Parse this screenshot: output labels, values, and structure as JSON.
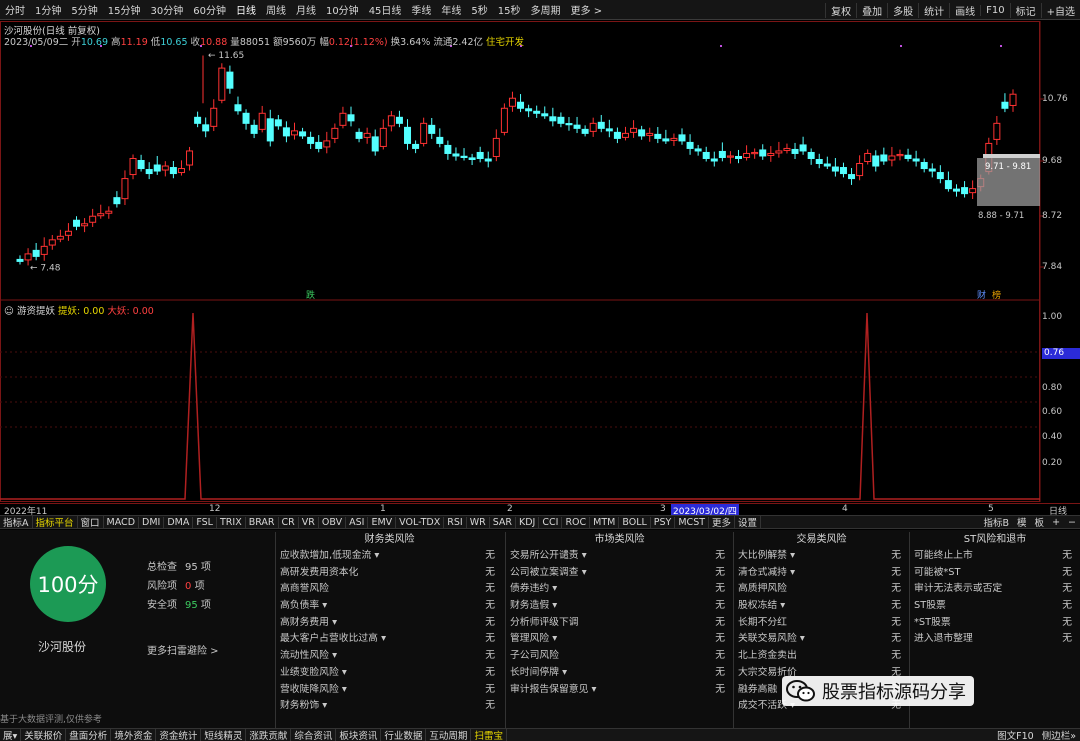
{
  "toolbar": {
    "timeframes": [
      "分时",
      "1分钟",
      "5分钟",
      "15分钟",
      "30分钟",
      "60分钟",
      "日线",
      "周线",
      "月线",
      "10分钟",
      "45日线",
      "季线",
      "年线",
      "5秒",
      "15秒",
      "多周期",
      "更多 >"
    ],
    "selected": "日线",
    "right": [
      "复权",
      "叠加",
      "多股",
      "统计",
      "画线",
      "F10",
      "标记",
      "+自选"
    ]
  },
  "stock": {
    "title": "沙河股份(日线 前复权)",
    "date": "2023/05/09二",
    "open_label": "开",
    "open": "10.69",
    "high_label": "高",
    "high": "11.19",
    "low_label": "低",
    "low": "10.65",
    "close_label": "收",
    "close": "10.88",
    "volume_label": "量",
    "volume": "88051",
    "amount_label": "额",
    "amount": "9560万",
    "change_label": "幅",
    "change": "0.12(1.12%)",
    "turnover_label": "换",
    "turnover": "3.64%",
    "float_label": "流通",
    "float": "2.42亿",
    "sector": "住宅开发"
  },
  "price_axis": {
    "labels": [
      "10.76",
      "9.68",
      "8.72",
      "7.84"
    ]
  },
  "annotations": {
    "high": "11.65",
    "low": "7.48",
    "range_top": "9.71 - 9.81",
    "range_bot": "8.88 - 9.71",
    "event1": "跌",
    "event2": "财",
    "event3": "榜"
  },
  "indicator": {
    "name": "游资提妖",
    "line1_label": "提妖",
    "line1_value": "0.00",
    "line2_label": "大妖",
    "line2_value": "0.00",
    "axis": [
      "1.00",
      "0.80",
      "0.60",
      "0.40",
      "0.20"
    ],
    "cursor_value": "0.76"
  },
  "chart_data": {
    "type": "line",
    "series": [
      {
        "name": "提妖",
        "x": [
          "2022-12-15",
          "2023-04-11"
        ],
        "values": [
          1.0,
          1.0
        ]
      }
    ],
    "ylim": [
      0,
      1.0
    ]
  },
  "date_axis": {
    "labels": [
      "2022年11",
      "12",
      "1",
      "2",
      "3",
      "2023/03/02/四",
      "4",
      "5"
    ],
    "right_label": "日线"
  },
  "indicator_tabs": [
    "指标A",
    "指标平台",
    "窗口",
    "MACD",
    "DMI",
    "DMA",
    "FSL",
    "TRIX",
    "BRAR",
    "CR",
    "VR",
    "OBV",
    "ASI",
    "EMV",
    "VOL-TDX",
    "RSI",
    "WR",
    "SAR",
    "KDJ",
    "CCI",
    "ROC",
    "MTM",
    "BOLL",
    "PSY",
    "MCST",
    "更多",
    "设置"
  ],
  "indicator_right": [
    "指标B",
    "模",
    "板",
    "+",
    "−"
  ],
  "risk": {
    "score": "100分",
    "name": "沙河股份",
    "total_label": "总检查",
    "total": "95",
    "total_unit": "项",
    "risk_label": "风险项",
    "risk_count": "0",
    "risk_unit": "项",
    "safe_label": "安全项",
    "safe": "95",
    "safe_unit": "项",
    "more": "更多扫雷避险 >",
    "footnote": "基于大数据评测,仅供参考",
    "columns": [
      {
        "title": "财务类风险",
        "items": [
          {
            "label": "应收款增加,低现金流 ▾",
            "value": "无"
          },
          {
            "label": "高研发费用资本化",
            "value": "无"
          },
          {
            "label": "高商誉风险",
            "value": "无"
          },
          {
            "label": "高负债率 ▾",
            "value": "无"
          },
          {
            "label": "高财务费用 ▾",
            "value": "无"
          },
          {
            "label": "最大客户占营收比过高 ▾",
            "value": "无"
          },
          {
            "label": "流动性风险 ▾",
            "value": "无"
          },
          {
            "label": "业绩变脸风险 ▾",
            "value": "无"
          },
          {
            "label": "营收陡降风险 ▾",
            "value": "无"
          },
          {
            "label": "财务粉饰 ▾",
            "value": "无"
          }
        ]
      },
      {
        "title": "市场类风险",
        "items": [
          {
            "label": "交易所公开谴责 ▾",
            "value": "无"
          },
          {
            "label": "公司被立案调查 ▾",
            "value": "无"
          },
          {
            "label": "债券违约 ▾",
            "value": "无"
          },
          {
            "label": "财务造假 ▾",
            "value": "无"
          },
          {
            "label": "分析师评级下调",
            "value": "无"
          },
          {
            "label": "管理风险 ▾",
            "value": "无"
          },
          {
            "label": "子公司风险",
            "value": "无"
          },
          {
            "label": "长时间停牌 ▾",
            "value": "无"
          },
          {
            "label": "审计报告保留意见 ▾",
            "value": "无"
          }
        ]
      },
      {
        "title": "交易类风险",
        "items": [
          {
            "label": "大比例解禁 ▾",
            "value": "无"
          },
          {
            "label": "清仓式减持 ▾",
            "value": "无"
          },
          {
            "label": "高质押风险",
            "value": "无"
          },
          {
            "label": "股权冻结 ▾",
            "value": "无"
          },
          {
            "label": "长期不分红",
            "value": "无"
          },
          {
            "label": "关联交易风险 ▾",
            "value": "无"
          },
          {
            "label": "北上资金卖出",
            "value": "无"
          },
          {
            "label": "大宗交易折价",
            "value": "无"
          },
          {
            "label": "融券高融",
            "value": "无"
          },
          {
            "label": "成交不活跃 ▾",
            "value": "无"
          }
        ]
      },
      {
        "title": "ST风险和退市",
        "items": [
          {
            "label": "可能终止上市",
            "value": "无"
          },
          {
            "label": "可能被*ST",
            "value": "无"
          },
          {
            "label": "审计无法表示或否定",
            "value": "无"
          },
          {
            "label": "ST股票",
            "value": "无"
          },
          {
            "label": "*ST股票",
            "value": "无"
          },
          {
            "label": "进入退市整理",
            "value": "无"
          }
        ]
      }
    ]
  },
  "watermark": "股票指标源码分享",
  "bottom_tabs": [
    "展▾",
    "关联报价",
    "盘面分析",
    "境外资金",
    "资金统计",
    "短线精灵",
    "涨跌贡献",
    "综合资讯",
    "板块资讯",
    "行业数据",
    "互动周期",
    "扫雷宝"
  ],
  "bottom_selected": "扫雷宝",
  "bottom_right": [
    "图文F10",
    "侧边栏»"
  ]
}
